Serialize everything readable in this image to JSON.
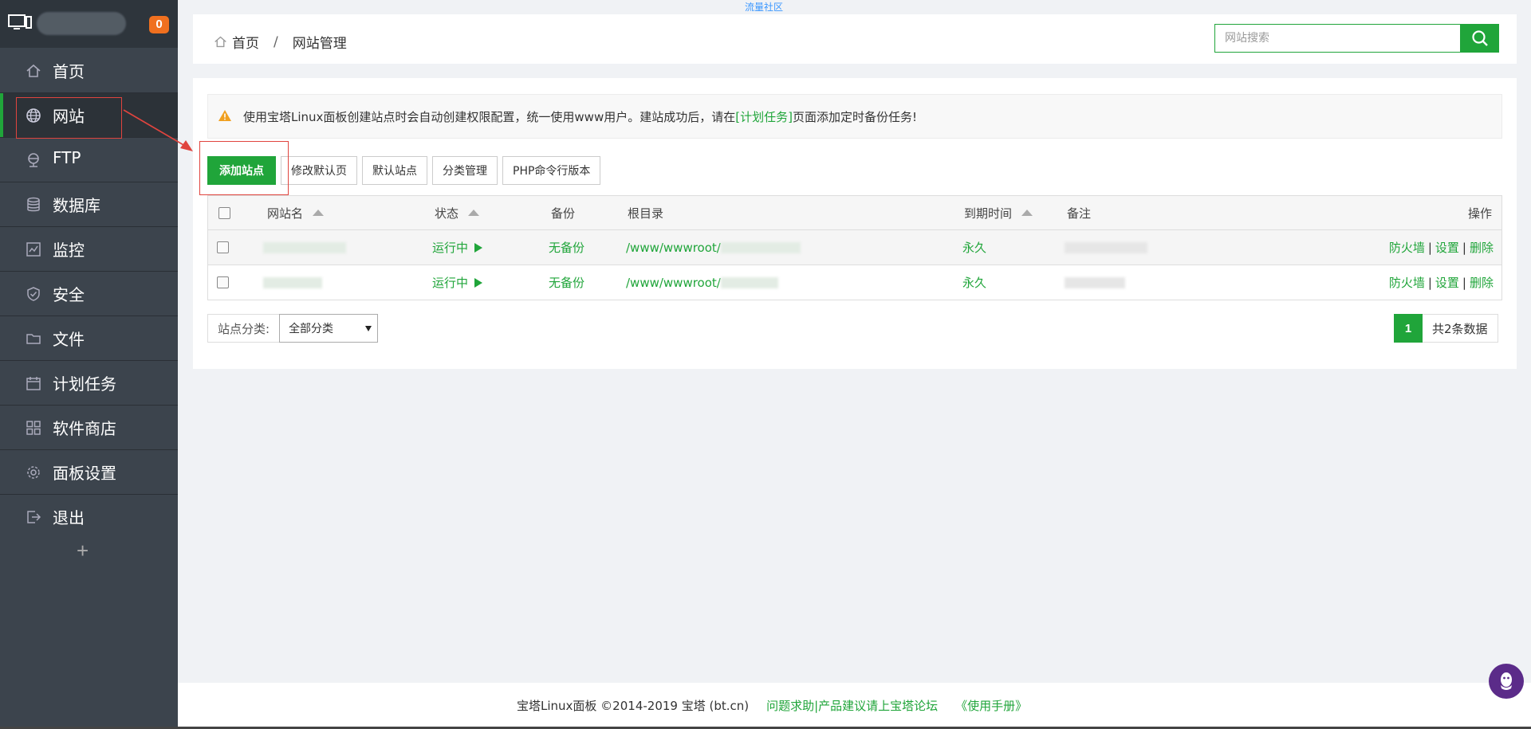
{
  "top_link": "流量社区",
  "sidebar": {
    "badge": "0",
    "items": [
      {
        "label": "首页",
        "icon": "home-icon"
      },
      {
        "label": "网站",
        "icon": "globe-icon"
      },
      {
        "label": "FTP",
        "icon": "ftp-icon"
      },
      {
        "label": "数据库",
        "icon": "database-icon"
      },
      {
        "label": "监控",
        "icon": "monitor-chart-icon"
      },
      {
        "label": "安全",
        "icon": "shield-icon"
      },
      {
        "label": "文件",
        "icon": "folder-icon"
      },
      {
        "label": "计划任务",
        "icon": "calendar-icon"
      },
      {
        "label": "软件商店",
        "icon": "apps-grid-icon"
      },
      {
        "label": "面板设置",
        "icon": "gear-icon"
      },
      {
        "label": "退出",
        "icon": "logout-icon"
      }
    ],
    "add": "+"
  },
  "header": {
    "breadcrumb_home": "首页",
    "breadcrumb_sep": "/",
    "breadcrumb_current": "网站管理",
    "search_placeholder": "网站搜索"
  },
  "notice": {
    "text_before": "使用宝塔Linux面板创建站点时会自动创建权限配置，统一使用www用户。建站成功后，请在",
    "link": "[计划任务]",
    "text_after": "页面添加定时备份任务!"
  },
  "buttons": {
    "add_site": "添加站点",
    "modify_default_page": "修改默认页",
    "default_site": "默认站点",
    "category_manage": "分类管理",
    "php_cli_version": "PHP命令行版本"
  },
  "table": {
    "columns": {
      "name": "网站名",
      "status": "状态",
      "backup": "备份",
      "root": "根目录",
      "expire": "到期时间",
      "note": "备注",
      "actions": "操作"
    },
    "rows": [
      {
        "status": "运行中",
        "backup": "无备份",
        "root_prefix": "/www/wwwroot/",
        "expire": "永久",
        "actions": [
          "防火墙",
          "设置",
          "删除"
        ]
      },
      {
        "status": "运行中",
        "backup": "无备份",
        "root_prefix": "/www/wwwroot/",
        "expire": "永久",
        "actions": [
          "防火墙",
          "设置",
          "删除"
        ]
      }
    ],
    "action_sep": "|"
  },
  "category": {
    "label": "站点分类:",
    "selected": "全部分类"
  },
  "pager": {
    "current": "1",
    "total": "共2条数据"
  },
  "footer": {
    "copyright": "宝塔Linux面板 ©2014-2019 宝塔 (bt.cn)",
    "forum_link": "问题求助|产品建议请上宝塔论坛",
    "manual_link": "《使用手册》"
  },
  "colors": {
    "accent": "#20a53a",
    "sidebar_bg": "#3c444d",
    "annotation": "#e0443e"
  }
}
